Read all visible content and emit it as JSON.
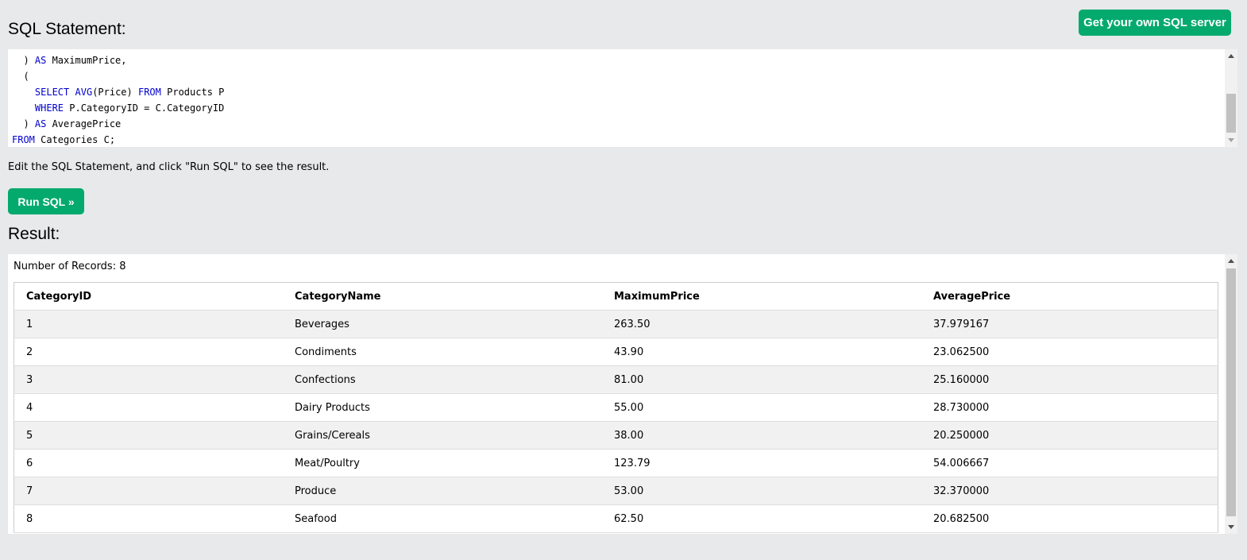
{
  "header": {
    "title": "SQL Statement:",
    "own_server_label": "Get your own SQL server"
  },
  "editor": {
    "lines": [
      [
        {
          "t": "  ) "
        },
        {
          "t": "AS",
          "kw": true
        },
        {
          "t": " MaximumPrice,"
        }
      ],
      [
        {
          "t": "  ("
        }
      ],
      [
        {
          "t": "    "
        },
        {
          "t": "SELECT",
          "kw": true
        },
        {
          "t": " "
        },
        {
          "t": "AVG",
          "kw": true
        },
        {
          "t": "(Price) "
        },
        {
          "t": "FROM",
          "kw": true
        },
        {
          "t": " Products P"
        }
      ],
      [
        {
          "t": "    "
        },
        {
          "t": "WHERE",
          "kw": true
        },
        {
          "t": " P.CategoryID = C.CategoryID"
        }
      ],
      [
        {
          "t": "  ) "
        },
        {
          "t": "AS",
          "kw": true
        },
        {
          "t": " AveragePrice"
        }
      ],
      [
        {
          "t": "FROM",
          "kw": true
        },
        {
          "t": " Categories C;"
        }
      ]
    ]
  },
  "hint": "Edit the SQL Statement, and click \"Run SQL\" to see the result.",
  "run_label": "Run SQL »",
  "result": {
    "title": "Result:",
    "records_text": "Number of Records: 8",
    "columns": [
      "CategoryID",
      "CategoryName",
      "MaximumPrice",
      "AveragePrice"
    ],
    "rows": [
      [
        "1",
        "Beverages",
        "263.50",
        "37.979167"
      ],
      [
        "2",
        "Condiments",
        "43.90",
        "23.062500"
      ],
      [
        "3",
        "Confections",
        "81.00",
        "25.160000"
      ],
      [
        "4",
        "Dairy Products",
        "55.00",
        "28.730000"
      ],
      [
        "5",
        "Grains/Cereals",
        "38.00",
        "20.250000"
      ],
      [
        "6",
        "Meat/Poultry",
        "123.79",
        "54.006667"
      ],
      [
        "7",
        "Produce",
        "53.00",
        "32.370000"
      ],
      [
        "8",
        "Seafood",
        "62.50",
        "20.682500"
      ]
    ]
  },
  "colors": {
    "accent": "#04aa6d",
    "keyword": "#0000cd",
    "page_bg": "#e7e9eb"
  }
}
